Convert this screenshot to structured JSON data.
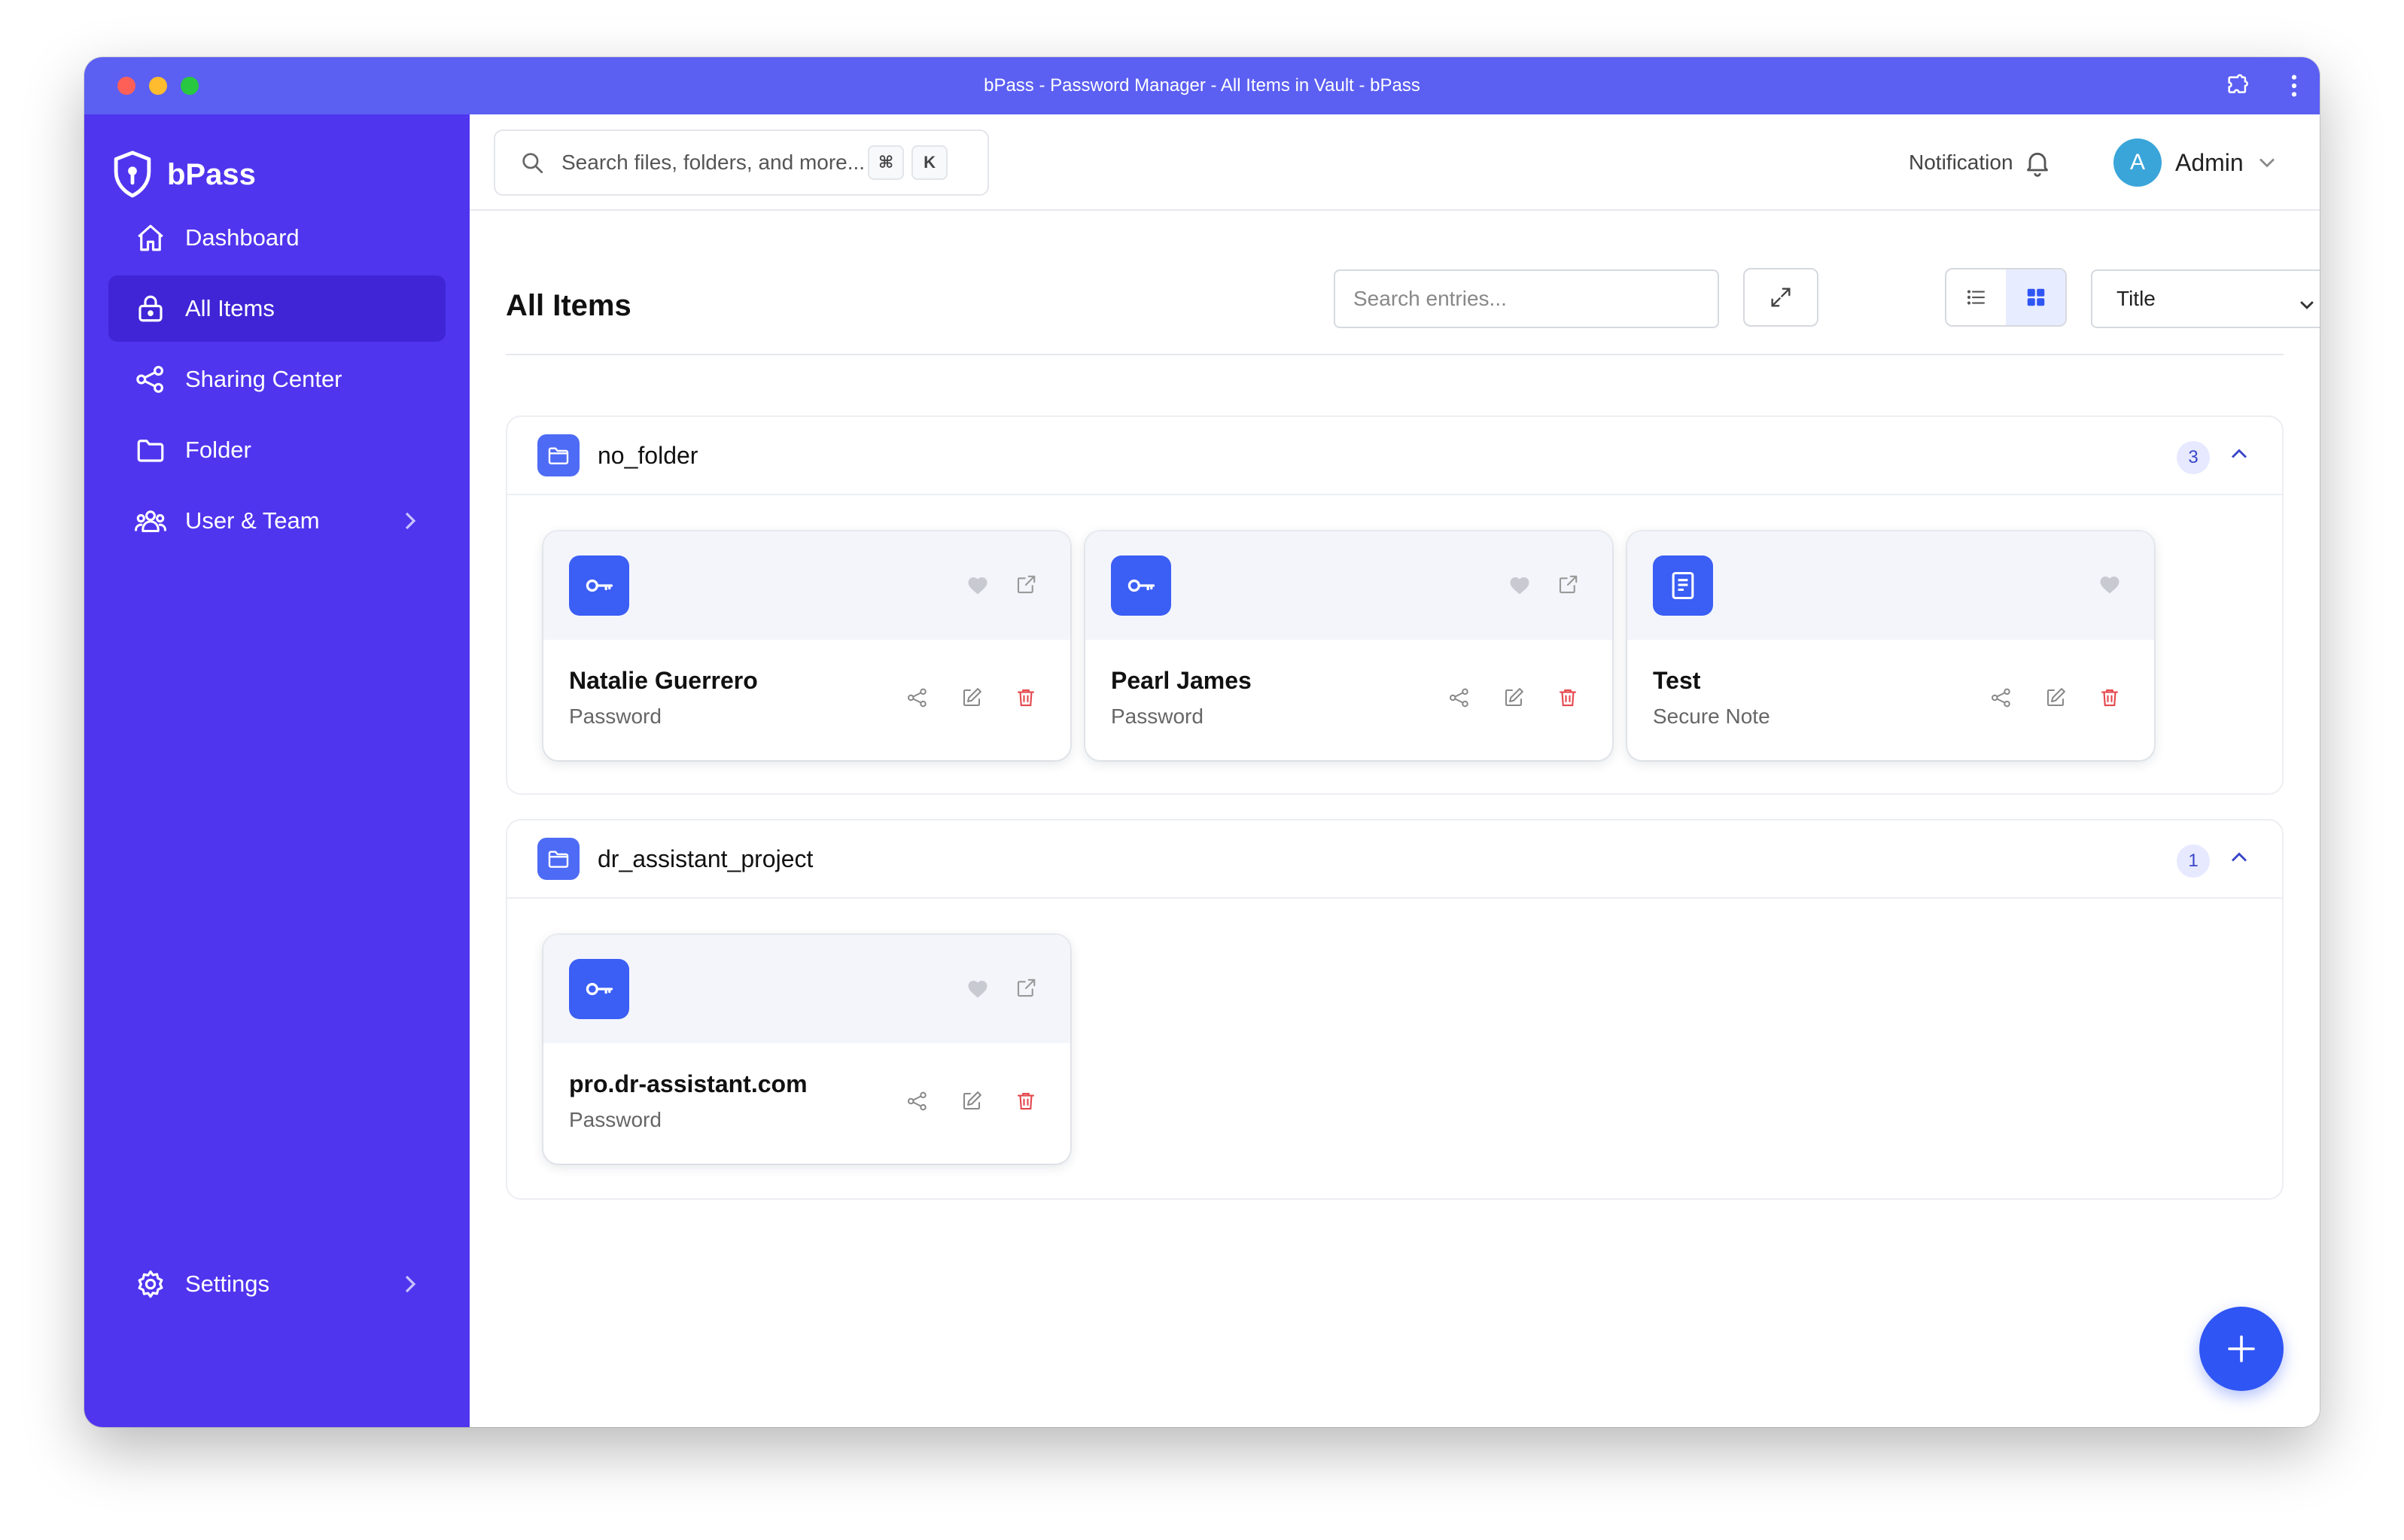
{
  "window": {
    "title": "bPass - Password Manager - All Items in Vault - bPass"
  },
  "brand": {
    "name": "bPass"
  },
  "sidebar": {
    "items": [
      {
        "label": "Dashboard",
        "icon": "home-icon"
      },
      {
        "label": "All Items",
        "icon": "lock-icon",
        "active": true
      },
      {
        "label": "Sharing Center",
        "icon": "share-icon"
      },
      {
        "label": "Folder",
        "icon": "folder-icon"
      },
      {
        "label": "User & Team",
        "icon": "users-icon",
        "has_submenu": true
      }
    ],
    "settings": {
      "label": "Settings",
      "icon": "gear-icon"
    }
  },
  "topbar": {
    "search_placeholder": "Search files, folders, and more...",
    "shortcut_keys": [
      "⌘",
      "K"
    ],
    "notification_label": "Notification",
    "user": {
      "initial": "A",
      "name": "Admin"
    }
  },
  "content": {
    "title": "All Items",
    "search_placeholder": "Search entries...",
    "sort_value": "Title",
    "view_mode": "grid"
  },
  "groups": [
    {
      "name": "no_folder",
      "count": "3",
      "items": [
        {
          "title": "Natalie Guerrero",
          "type": "Password",
          "icon": "key-icon"
        },
        {
          "title": "Pearl James",
          "type": "Password",
          "icon": "key-icon"
        },
        {
          "title": "Test",
          "type": "Secure Note",
          "icon": "note-icon"
        }
      ]
    },
    {
      "name": "dr_assistant_project",
      "count": "1",
      "items": [
        {
          "title": "pro.dr-assistant.com",
          "type": "Password",
          "icon": "key-icon"
        }
      ]
    }
  ],
  "colors": {
    "titlebar": "#5b5ff2",
    "sidebar": "#4f35ee",
    "sidebar_active": "#4025d6",
    "accent": "#3b5ef5",
    "delete": "#e5484d"
  }
}
